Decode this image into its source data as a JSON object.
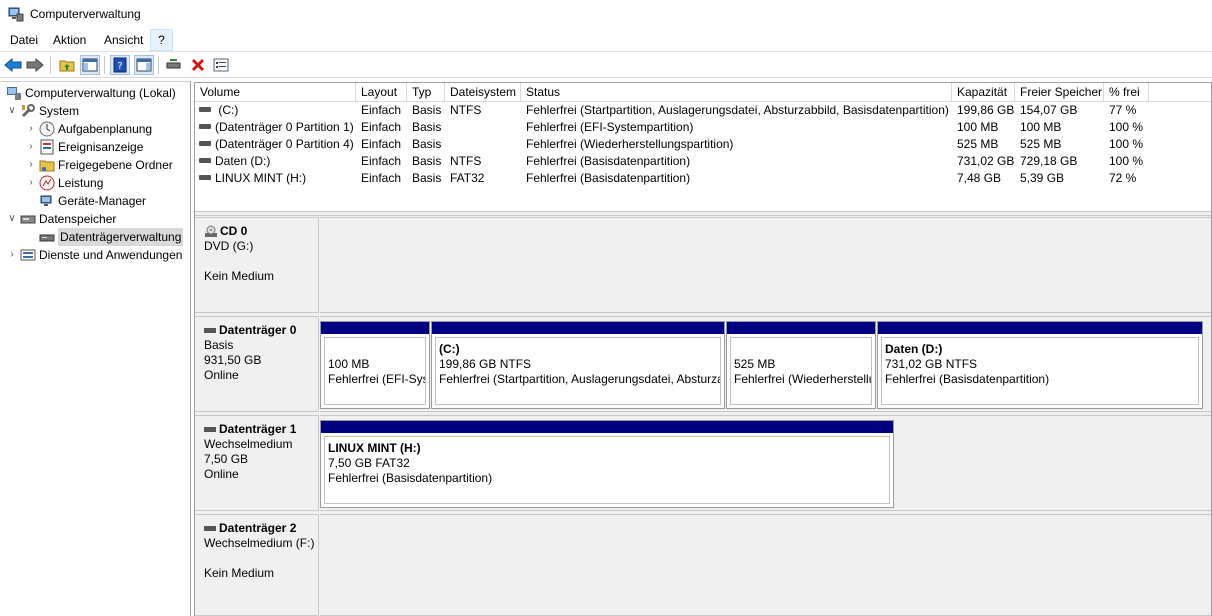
{
  "window": {
    "title": "Computerverwaltung"
  },
  "menu": [
    {
      "label": "Datei",
      "active": false
    },
    {
      "label": "Aktion",
      "active": false
    },
    {
      "label": "Ansicht",
      "active": false
    },
    {
      "label": "?",
      "active": true
    }
  ],
  "toolbar": [
    "back-icon",
    "forward-icon",
    "up-folder-icon",
    "show-hide-tree-icon",
    "help-icon",
    "show-hide-action-pane-icon",
    "connect-drive-icon",
    "delete-icon",
    "properties-icon"
  ],
  "tree": {
    "root": "Computerverwaltung (Lokal)",
    "system": "System",
    "aufgaben": "Aufgabenplanung",
    "ereignis": "Ereignisanzeige",
    "freigaben": "Freigegebene Ordner",
    "leistung": "Leistung",
    "geraete": "Geräte-Manager",
    "datenspeicher": "Datenspeicher",
    "datentraeger": "Datenträgerverwaltung",
    "dienste": "Dienste und Anwendungen"
  },
  "volumes": {
    "headers": {
      "volume": "Volume",
      "layout": "Layout",
      "typ": "Typ",
      "fs": "Dateisystem",
      "status": "Status",
      "kap": "Kapazität",
      "frei": "Freier Speicher",
      "proz": "% frei"
    },
    "rows": [
      {
        "volume": " (C:)",
        "layout": "Einfach",
        "typ": "Basis",
        "fs": "NTFS",
        "status": "Fehlerfrei (Startpartition, Auslagerungsdatei, Absturzabbild, Basisdatenpartition)",
        "kap": "199,86 GB",
        "frei": "154,07 GB",
        "proz": "77 %"
      },
      {
        "volume": "(Datenträger 0 Partition 1)",
        "layout": "Einfach",
        "typ": "Basis",
        "fs": "",
        "status": "Fehlerfrei (EFI-Systempartition)",
        "kap": "100 MB",
        "frei": "100 MB",
        "proz": "100 %"
      },
      {
        "volume": "(Datenträger 0 Partition 4)",
        "layout": "Einfach",
        "typ": "Basis",
        "fs": "",
        "status": "Fehlerfrei (Wiederherstellungspartition)",
        "kap": "525 MB",
        "frei": "525 MB",
        "proz": "100 %"
      },
      {
        "volume": "Daten (D:)",
        "layout": "Einfach",
        "typ": "Basis",
        "fs": "NTFS",
        "status": "Fehlerfrei (Basisdatenpartition)",
        "kap": "731,02 GB",
        "frei": "729,18 GB",
        "proz": "100 %"
      },
      {
        "volume": "LINUX MINT (H:)",
        "layout": "Einfach",
        "typ": "Basis",
        "fs": "FAT32",
        "status": "Fehlerfrei (Basisdatenpartition)",
        "kap": "7,48 GB",
        "frei": "5,39 GB",
        "proz": "72 %"
      }
    ]
  },
  "disks": {
    "cd0": {
      "name": "CD 0",
      "l1": "DVD (G:)",
      "l2": "",
      "l3": "Kein Medium"
    },
    "d0": {
      "name": "Datenträger 0",
      "l1": "Basis",
      "l2": "931,50 GB",
      "l3": "Online",
      "parts": [
        {
          "name": "",
          "size": "100 MB",
          "status": "Fehlerfrei (EFI-Systempartition)"
        },
        {
          "name": " (C:)",
          "size": "199,86 GB NTFS",
          "status": "Fehlerfrei (Startpartition, Auslagerungsdatei, Absturzabbild, Basisdatenpartition)"
        },
        {
          "name": "",
          "size": "525 MB",
          "status": "Fehlerfrei (Wiederherstellungspartition)"
        },
        {
          "name": "Daten  (D:)",
          "size": "731,02 GB NTFS",
          "status": "Fehlerfrei (Basisdatenpartition)"
        }
      ]
    },
    "d1": {
      "name": "Datenträger 1",
      "l1": "Wechselmedium",
      "l2": "7,50 GB",
      "l3": "Online",
      "parts": [
        {
          "name": "LINUX MINT  (H:)",
          "size": "7,50 GB FAT32",
          "status": "Fehlerfrei (Basisdatenpartition)"
        }
      ]
    },
    "d2": {
      "name": "Datenträger 2",
      "l1": "Wechselmedium (F:)",
      "l2": "",
      "l3": "Kein Medium"
    }
  },
  "colors": {
    "partition_bar": "#000080",
    "selection": "#d9d9d9",
    "graph_bg": "#f0f0f0"
  }
}
